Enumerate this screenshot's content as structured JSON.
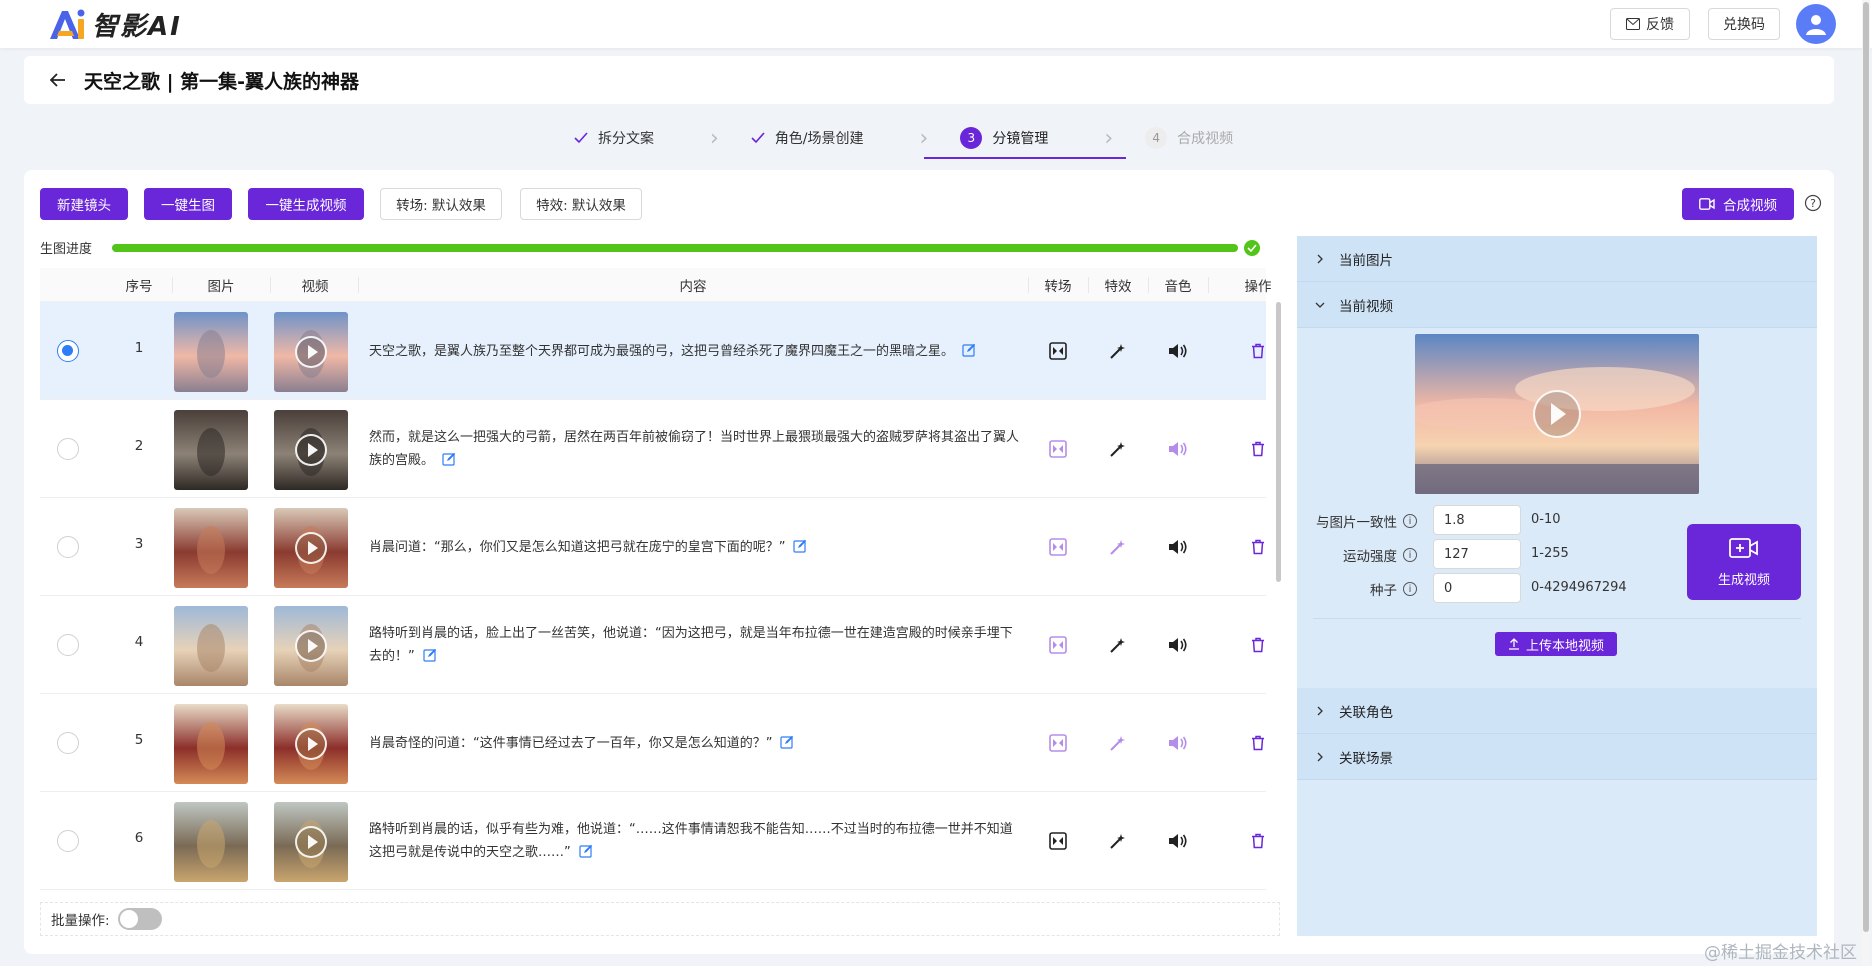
{
  "header": {
    "logo_text": "智影AI",
    "feedback_label": "反馈",
    "redeem_label": "兑换码"
  },
  "title": {
    "text": "天空之歌 | 第一集-翼人族的神器"
  },
  "steps": [
    {
      "label": "拆分文案",
      "state": "done"
    },
    {
      "label": "角色/场景创建",
      "state": "done"
    },
    {
      "num": "3",
      "label": "分镜管理",
      "state": "active"
    },
    {
      "num": "4",
      "label": "合成视频",
      "state": "disabled"
    }
  ],
  "toolbar": {
    "new_shot": "新建镜头",
    "gen_all_images": "一键生图",
    "gen_all_videos": "一键生成视频",
    "transition": "转场: 默认效果",
    "effect": "特效: 默认效果",
    "compose": "合成视频"
  },
  "progress": {
    "label": "生图进度",
    "value": 1.0
  },
  "table": {
    "columns": [
      "序号",
      "图片",
      "视频",
      "内容",
      "转场",
      "特效",
      "音色",
      "操作"
    ],
    "rows": [
      {
        "seq": "1",
        "selected": true,
        "content": "天空之歌，是翼人族乃至整个天界都可成为最强的弓，这把弓曾经杀死了魔界四魔王之一的黑暗之星。",
        "transition_active": true,
        "effect_active": true,
        "voice_active": true
      },
      {
        "seq": "2",
        "selected": false,
        "content": "然而，就是这么一把强大的弓箭，居然在两百年前被偷窃了！当时世界上最猥琐最强大的盗贼罗萨将其盗出了翼人族的宫殿。",
        "transition_active": false,
        "effect_active": true,
        "voice_active": false
      },
      {
        "seq": "3",
        "selected": false,
        "content": "肖晨问道：“那么，你们又是怎么知道这把弓就在庞宁的皇宫下面的呢？”",
        "transition_active": false,
        "effect_active": false,
        "voice_active": true
      },
      {
        "seq": "4",
        "selected": false,
        "content": "路特听到肖晨的话，脸上出了一丝苦笑，他说道：“因为这把弓，就是当年布拉德一世在建造宫殿的时候亲手埋下去的！”",
        "transition_active": false,
        "effect_active": true,
        "voice_active": true
      },
      {
        "seq": "5",
        "selected": false,
        "content": "肖晨奇怪的问道：“这件事情已经过去了一百年，你又是怎么知道的？”",
        "transition_active": false,
        "effect_active": false,
        "voice_active": false
      },
      {
        "seq": "6",
        "selected": false,
        "content": "路特听到肖晨的话，似乎有些为难，他说道：“……这件事情请恕我不能告知……不过当时的布拉德一世并不知道这把弓就是传说中的天空之歌……”",
        "transition_active": true,
        "effect_active": true,
        "voice_active": true
      }
    ]
  },
  "batch": {
    "label": "批量操作:",
    "enabled": false
  },
  "right_panel": {
    "sections": {
      "current_image": "当前图片",
      "current_video": "当前视频",
      "related_roles": "关联角色",
      "related_scenes": "关联场景"
    },
    "params": [
      {
        "label": "与图片一致性",
        "value": "1.8",
        "range": "0-10"
      },
      {
        "label": "运动强度",
        "value": "127",
        "range": "1-255"
      },
      {
        "label": "种子",
        "value": "0",
        "range": "0-4294967294"
      }
    ],
    "gen_video_label": "生成视频",
    "upload_label": "上传本地视频"
  },
  "watermark": "@稀土掘金技术社区",
  "colors": {
    "primary": "#6a26d9",
    "progress": "#52c41a",
    "selected_row": "#e6f1fd",
    "panel_bg": "#dbeaf9"
  }
}
